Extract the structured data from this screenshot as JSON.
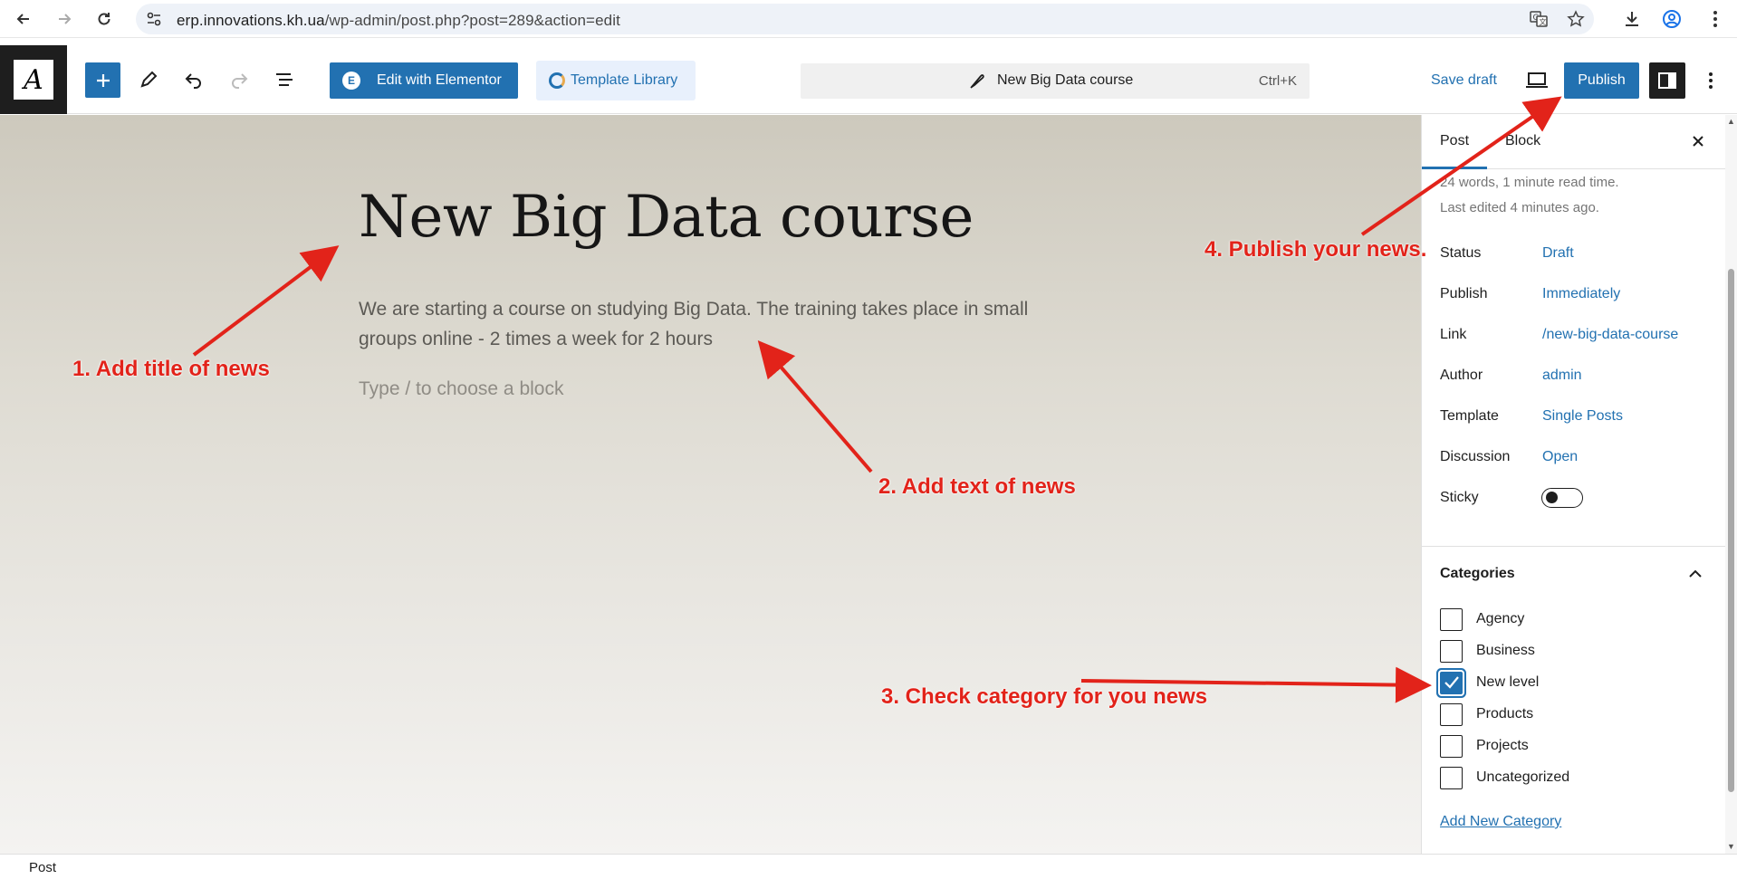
{
  "browser": {
    "url_host": "erp.innovations.kh.ua",
    "url_path": "/wp-admin/post.php?post=289&action=edit"
  },
  "toolbar": {
    "elementor_label": "Edit with Elementor",
    "template_label": "Template Library",
    "doc_title": "New Big Data course",
    "shortcut": "Ctrl+K",
    "save_draft": "Save draft",
    "publish": "Publish"
  },
  "post": {
    "title": "New Big Data course",
    "body": "We are starting a course on studying Big Data. The training takes place in small groups online - 2 times a week for 2 hours",
    "placeholder": "Type / to choose a block"
  },
  "annotations": {
    "a1": "1. Add title of news",
    "a2": "2. Add text of news",
    "a3": "3. Check category for you news",
    "a4": "4. Publish your news."
  },
  "sidebar": {
    "tabs": [
      "Post",
      "Block"
    ],
    "words": "24 words, 1 minute read time.",
    "last_edited": "Last edited 4 minutes ago.",
    "rows": [
      {
        "label": "Status",
        "value": "Draft"
      },
      {
        "label": "Publish",
        "value": "Immediately"
      },
      {
        "label": "Link",
        "value": "/new-big-data-course"
      },
      {
        "label": "Author",
        "value": "admin"
      },
      {
        "label": "Template",
        "value": "Single Posts"
      },
      {
        "label": "Discussion",
        "value": "Open"
      }
    ],
    "sticky_label": "Sticky",
    "sticky_on": false,
    "categories_title": "Categories",
    "categories": [
      {
        "label": "Agency",
        "checked": false
      },
      {
        "label": "Business",
        "checked": false
      },
      {
        "label": "New level",
        "checked": true
      },
      {
        "label": "Products",
        "checked": false
      },
      {
        "label": "Projects",
        "checked": false
      },
      {
        "label": "Uncategorized",
        "checked": false
      }
    ],
    "add_category": "Add New Category"
  },
  "footer": {
    "breadcrumb": "Post"
  },
  "colors": {
    "accent": "#2271b1",
    "annotation": "#e2231a"
  }
}
